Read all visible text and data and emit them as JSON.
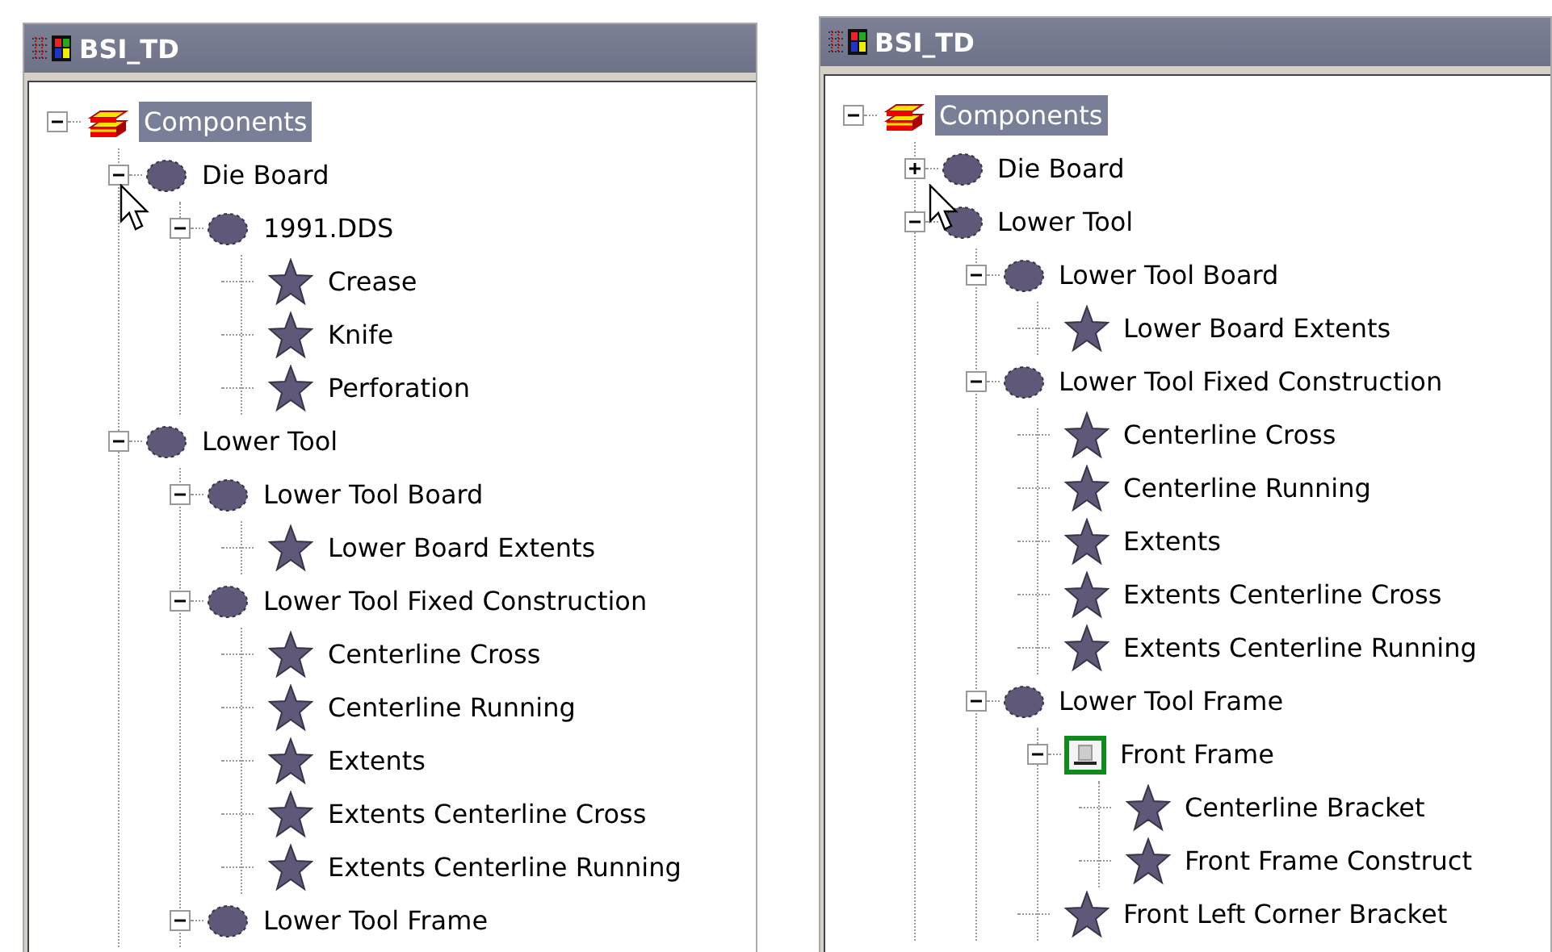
{
  "panels": [
    {
      "title": "BSI_TD",
      "tree": [
        {
          "label": "Components",
          "kind": "layers",
          "expanded": true,
          "selected": true,
          "children": [
            {
              "label": "Die Board",
              "kind": "ellipse",
              "expanded": true,
              "selected": false,
              "children": [
                {
                  "label": "1991.DDS",
                  "kind": "ellipse",
                  "expanded": true,
                  "selected": false,
                  "children": [
                    {
                      "label": "Crease",
                      "kind": "star",
                      "selected": false
                    },
                    {
                      "label": "Knife",
                      "kind": "star",
                      "selected": false
                    },
                    {
                      "label": "Perforation",
                      "kind": "star",
                      "selected": false
                    }
                  ]
                }
              ]
            },
            {
              "label": "Lower Tool",
              "kind": "ellipse",
              "expanded": true,
              "selected": false,
              "children": [
                {
                  "label": "Lower Tool Board",
                  "kind": "ellipse",
                  "expanded": true,
                  "selected": false,
                  "children": [
                    {
                      "label": "Lower Board Extents",
                      "kind": "star",
                      "selected": false
                    }
                  ]
                },
                {
                  "label": "Lower Tool Fixed Construction",
                  "kind": "ellipse",
                  "expanded": true,
                  "selected": false,
                  "children": [
                    {
                      "label": "Centerline Cross",
                      "kind": "star",
                      "selected": false
                    },
                    {
                      "label": "Centerline Running",
                      "kind": "star",
                      "selected": false
                    },
                    {
                      "label": "Extents",
                      "kind": "star",
                      "selected": false
                    },
                    {
                      "label": "Extents Centerline Cross",
                      "kind": "star",
                      "selected": false
                    },
                    {
                      "label": "Extents Centerline Running",
                      "kind": "star",
                      "selected": false
                    }
                  ]
                },
                {
                  "label": "Lower Tool Frame",
                  "kind": "ellipse",
                  "expanded": true,
                  "selected": false
                }
              ]
            }
          ]
        }
      ]
    },
    {
      "title": "BSI_TD",
      "tree": [
        {
          "label": "Components",
          "kind": "layers",
          "expanded": true,
          "selected": true,
          "children": [
            {
              "label": "Die Board",
              "kind": "ellipse",
              "expanded": false,
              "selected": false
            },
            {
              "label": "Lower Tool",
              "kind": "ellipse",
              "expanded": true,
              "selected": false,
              "children": [
                {
                  "label": "Lower Tool Board",
                  "kind": "ellipse",
                  "expanded": true,
                  "selected": false,
                  "children": [
                    {
                      "label": "Lower Board Extents",
                      "kind": "star",
                      "selected": false
                    }
                  ]
                },
                {
                  "label": "Lower Tool Fixed Construction",
                  "kind": "ellipse",
                  "expanded": true,
                  "selected": false,
                  "children": [
                    {
                      "label": "Centerline Cross",
                      "kind": "star",
                      "selected": false
                    },
                    {
                      "label": "Centerline Running",
                      "kind": "star",
                      "selected": false
                    },
                    {
                      "label": "Extents",
                      "kind": "star",
                      "selected": false
                    },
                    {
                      "label": "Extents Centerline Cross",
                      "kind": "star",
                      "selected": false
                    },
                    {
                      "label": "Extents Centerline Running",
                      "kind": "star",
                      "selected": false
                    }
                  ]
                },
                {
                  "label": "Lower Tool Frame",
                  "kind": "ellipse",
                  "expanded": true,
                  "selected": false,
                  "children": [
                    {
                      "label": "Front Frame",
                      "kind": "frame",
                      "expanded": true,
                      "selected": false,
                      "children": [
                        {
                          "label": "Centerline Bracket",
                          "kind": "star",
                          "selected": false
                        },
                        {
                          "label": "Front Frame Construct",
                          "kind": "star",
                          "selected": false
                        }
                      ]
                    },
                    {
                      "label": "Front Left Corner Bracket",
                      "kind": "star",
                      "selected": false
                    }
                  ]
                }
              ]
            }
          ]
        }
      ]
    }
  ]
}
